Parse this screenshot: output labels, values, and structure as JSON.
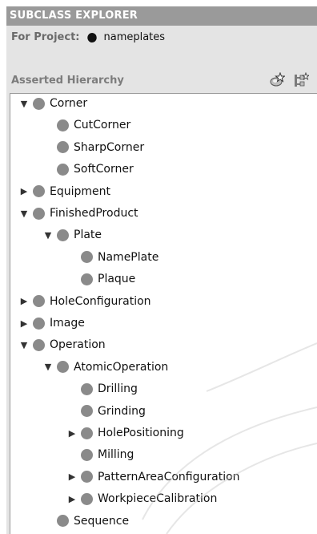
{
  "panel": {
    "title": "SUBCLASS EXPLORER",
    "project_label": "For Project:",
    "project_name": "nameplates",
    "hierarchy_label": "Asserted Hierarchy"
  },
  "tree": {
    "nodes": [
      {
        "label": "Corner",
        "toggle": "expanded",
        "depth": 0
      },
      {
        "label": "CutCorner",
        "toggle": "none",
        "depth": 1
      },
      {
        "label": "SharpCorner",
        "toggle": "none",
        "depth": 1
      },
      {
        "label": "SoftCorner",
        "toggle": "none",
        "depth": 1
      },
      {
        "label": "Equipment",
        "toggle": "collapsed",
        "depth": 0
      },
      {
        "label": "FinishedProduct",
        "toggle": "expanded",
        "depth": 0
      },
      {
        "label": "Plate",
        "toggle": "expanded",
        "depth": 1
      },
      {
        "label": "NamePlate",
        "toggle": "none",
        "depth": 2
      },
      {
        "label": "Plaque",
        "toggle": "none",
        "depth": 2
      },
      {
        "label": "HoleConfiguration",
        "toggle": "collapsed",
        "depth": 0
      },
      {
        "label": "Image",
        "toggle": "collapsed",
        "depth": 0
      },
      {
        "label": "Operation",
        "toggle": "expanded",
        "depth": 0
      },
      {
        "label": "AtomicOperation",
        "toggle": "expanded",
        "depth": 1
      },
      {
        "label": "Drilling",
        "toggle": "none",
        "depth": 2
      },
      {
        "label": "Grinding",
        "toggle": "none",
        "depth": 2
      },
      {
        "label": "HolePositioning",
        "toggle": "collapsed",
        "depth": 2
      },
      {
        "label": "Milling",
        "toggle": "none",
        "depth": 2
      },
      {
        "label": "PatternAreaConfiguration",
        "toggle": "collapsed",
        "depth": 2
      },
      {
        "label": "WorkpieceCalibration",
        "toggle": "collapsed",
        "depth": 2
      },
      {
        "label": "Sequence",
        "toggle": "none",
        "depth": 1
      }
    ]
  },
  "icons": {
    "project": "project-icon",
    "create_subclass": "create-subclass-icon",
    "create_sibling": "create-sibling-icon",
    "class_bullet": "class-bullet-icon"
  },
  "colors": {
    "title_bar": "#9a9a9a",
    "panel_bg": "#e4e4e4",
    "class_bullet": "#8a8a8a"
  }
}
